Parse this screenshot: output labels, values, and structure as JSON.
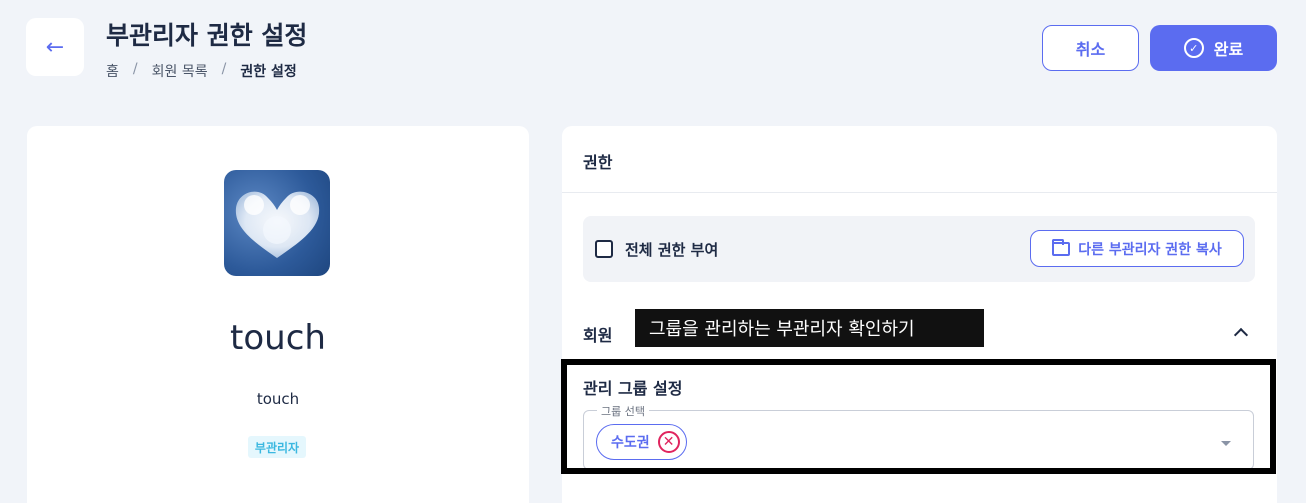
{
  "header": {
    "title": "부관리자 권한 설정",
    "breadcrumb": [
      "홈",
      "회원 목록",
      "권한 설정"
    ],
    "back_icon": "←",
    "cancel_label": "취소",
    "done_label": "완료",
    "done_icon": "✓"
  },
  "profile": {
    "name": "touch",
    "id": "touch",
    "role": "부관리자"
  },
  "permissions": {
    "title": "권한",
    "grant_all_label": "전체 권한 부여",
    "copy_label": "다른 부관리자 권한 복사",
    "section": "회원",
    "tooltip": "그룹을 관리하는 부관리자 확인하기",
    "group_title": "관리 그룹 설정",
    "group_select_legend": "그룹 선택",
    "selected_chip": "수도권",
    "chip_remove_icon": "✕"
  },
  "colors": {
    "accent": "#5b6cf0",
    "background": "#f1f4f9",
    "danger": "#e0245e",
    "badge_text": "#3bb8e0"
  }
}
